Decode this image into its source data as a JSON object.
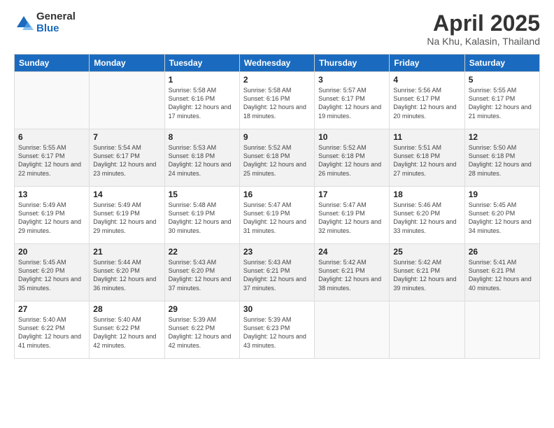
{
  "logo": {
    "general": "General",
    "blue": "Blue"
  },
  "title": {
    "month_year": "April 2025",
    "location": "Na Khu, Kalasin, Thailand"
  },
  "days_of_week": [
    "Sunday",
    "Monday",
    "Tuesday",
    "Wednesday",
    "Thursday",
    "Friday",
    "Saturday"
  ],
  "weeks": [
    [
      {
        "day": "",
        "info": ""
      },
      {
        "day": "",
        "info": ""
      },
      {
        "day": "1",
        "info": "Sunrise: 5:58 AM\nSunset: 6:16 PM\nDaylight: 12 hours and 17 minutes."
      },
      {
        "day": "2",
        "info": "Sunrise: 5:58 AM\nSunset: 6:16 PM\nDaylight: 12 hours and 18 minutes."
      },
      {
        "day": "3",
        "info": "Sunrise: 5:57 AM\nSunset: 6:17 PM\nDaylight: 12 hours and 19 minutes."
      },
      {
        "day": "4",
        "info": "Sunrise: 5:56 AM\nSunset: 6:17 PM\nDaylight: 12 hours and 20 minutes."
      },
      {
        "day": "5",
        "info": "Sunrise: 5:55 AM\nSunset: 6:17 PM\nDaylight: 12 hours and 21 minutes."
      }
    ],
    [
      {
        "day": "6",
        "info": "Sunrise: 5:55 AM\nSunset: 6:17 PM\nDaylight: 12 hours and 22 minutes."
      },
      {
        "day": "7",
        "info": "Sunrise: 5:54 AM\nSunset: 6:17 PM\nDaylight: 12 hours and 23 minutes."
      },
      {
        "day": "8",
        "info": "Sunrise: 5:53 AM\nSunset: 6:18 PM\nDaylight: 12 hours and 24 minutes."
      },
      {
        "day": "9",
        "info": "Sunrise: 5:52 AM\nSunset: 6:18 PM\nDaylight: 12 hours and 25 minutes."
      },
      {
        "day": "10",
        "info": "Sunrise: 5:52 AM\nSunset: 6:18 PM\nDaylight: 12 hours and 26 minutes."
      },
      {
        "day": "11",
        "info": "Sunrise: 5:51 AM\nSunset: 6:18 PM\nDaylight: 12 hours and 27 minutes."
      },
      {
        "day": "12",
        "info": "Sunrise: 5:50 AM\nSunset: 6:18 PM\nDaylight: 12 hours and 28 minutes."
      }
    ],
    [
      {
        "day": "13",
        "info": "Sunrise: 5:49 AM\nSunset: 6:19 PM\nDaylight: 12 hours and 29 minutes."
      },
      {
        "day": "14",
        "info": "Sunrise: 5:49 AM\nSunset: 6:19 PM\nDaylight: 12 hours and 29 minutes."
      },
      {
        "day": "15",
        "info": "Sunrise: 5:48 AM\nSunset: 6:19 PM\nDaylight: 12 hours and 30 minutes."
      },
      {
        "day": "16",
        "info": "Sunrise: 5:47 AM\nSunset: 6:19 PM\nDaylight: 12 hours and 31 minutes."
      },
      {
        "day": "17",
        "info": "Sunrise: 5:47 AM\nSunset: 6:19 PM\nDaylight: 12 hours and 32 minutes."
      },
      {
        "day": "18",
        "info": "Sunrise: 5:46 AM\nSunset: 6:20 PM\nDaylight: 12 hours and 33 minutes."
      },
      {
        "day": "19",
        "info": "Sunrise: 5:45 AM\nSunset: 6:20 PM\nDaylight: 12 hours and 34 minutes."
      }
    ],
    [
      {
        "day": "20",
        "info": "Sunrise: 5:45 AM\nSunset: 6:20 PM\nDaylight: 12 hours and 35 minutes."
      },
      {
        "day": "21",
        "info": "Sunrise: 5:44 AM\nSunset: 6:20 PM\nDaylight: 12 hours and 36 minutes."
      },
      {
        "day": "22",
        "info": "Sunrise: 5:43 AM\nSunset: 6:20 PM\nDaylight: 12 hours and 37 minutes."
      },
      {
        "day": "23",
        "info": "Sunrise: 5:43 AM\nSunset: 6:21 PM\nDaylight: 12 hours and 37 minutes."
      },
      {
        "day": "24",
        "info": "Sunrise: 5:42 AM\nSunset: 6:21 PM\nDaylight: 12 hours and 38 minutes."
      },
      {
        "day": "25",
        "info": "Sunrise: 5:42 AM\nSunset: 6:21 PM\nDaylight: 12 hours and 39 minutes."
      },
      {
        "day": "26",
        "info": "Sunrise: 5:41 AM\nSunset: 6:21 PM\nDaylight: 12 hours and 40 minutes."
      }
    ],
    [
      {
        "day": "27",
        "info": "Sunrise: 5:40 AM\nSunset: 6:22 PM\nDaylight: 12 hours and 41 minutes."
      },
      {
        "day": "28",
        "info": "Sunrise: 5:40 AM\nSunset: 6:22 PM\nDaylight: 12 hours and 42 minutes."
      },
      {
        "day": "29",
        "info": "Sunrise: 5:39 AM\nSunset: 6:22 PM\nDaylight: 12 hours and 42 minutes."
      },
      {
        "day": "30",
        "info": "Sunrise: 5:39 AM\nSunset: 6:23 PM\nDaylight: 12 hours and 43 minutes."
      },
      {
        "day": "",
        "info": ""
      },
      {
        "day": "",
        "info": ""
      },
      {
        "day": "",
        "info": ""
      }
    ]
  ]
}
